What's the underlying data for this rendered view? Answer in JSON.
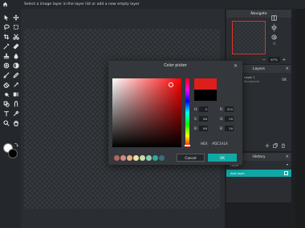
{
  "topbar": {
    "hint": "Select a image layer in the layer list or add a new empty layer"
  },
  "tools": [
    "select-arrow-icon",
    "move-icon",
    "lasso-icon",
    "crop-icon",
    "magic-wand-icon",
    "brush-icon",
    "stamp-icon",
    "drop-icon",
    "eraser-icon",
    "fill-icon",
    "text-icon",
    "eyedropper-icon",
    "zoom-icon",
    "hand-icon"
  ],
  "colors": {
    "foreground": "#ffffff",
    "background": "#000000",
    "accent": "#10a7a5"
  },
  "navigate": {
    "title": "Navigate",
    "x_label": "X:",
    "y_label": "Y:",
    "w_label": "W:",
    "h_label": "H:",
    "zoom_minus": "−",
    "zoom_plus": "+",
    "zoom_value": "67%"
  },
  "layers": {
    "title": "Layers",
    "items": [
      {
        "name": "Layer 1",
        "sub": "Background",
        "toggle": "OK"
      }
    ]
  },
  "history": {
    "title": "History",
    "items": [
      {
        "label": "Layer"
      },
      {
        "label": "Add layer"
      }
    ]
  },
  "color_picker": {
    "title": "Color picker",
    "close": "×",
    "fields": [
      {
        "label": "H:",
        "value": "0"
      },
      {
        "label": "R:",
        "value": "220"
      },
      {
        "label": "S:",
        "value": "88"
      },
      {
        "label": "G:",
        "value": "26"
      },
      {
        "label": "B:",
        "value": "86"
      },
      {
        "label": "B:",
        "value": "26"
      }
    ],
    "hex_label": "HEX:",
    "hex_value": "#DC1A1A",
    "new_color": "#dc1f1a",
    "old_color": "#000000",
    "presets": [
      "#b0675e",
      "#d6887c",
      "#e3b089",
      "#efe2a1",
      "#c8ddb0",
      "#8ecbb1",
      "#2fa9a0",
      "#3c6f7a"
    ],
    "cancel_label": "Cancel",
    "ok_label": "OK"
  }
}
